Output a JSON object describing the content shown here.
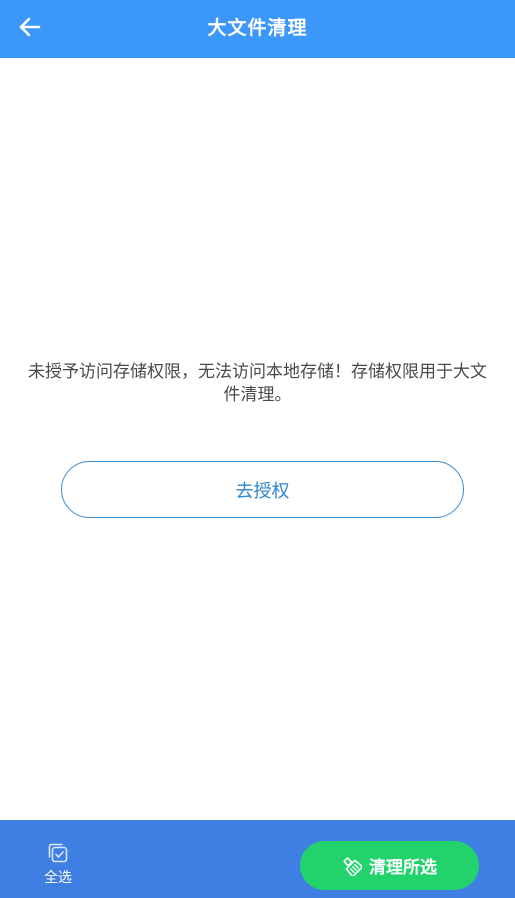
{
  "header": {
    "title": "大文件清理",
    "back_icon": "arrow-left-icon"
  },
  "main": {
    "message": "未授予访问存储权限，无法访问本地存储！存储权限用于大文件清理。",
    "authorize_label": "去授权"
  },
  "footer": {
    "select_all_label": "全选",
    "select_all_icon": "checkbox-stack-icon",
    "clean_label": "清理所选",
    "clean_icon": "broom-icon"
  },
  "colors": {
    "header_bg": "#3c97fa",
    "footer_bg": "#3f7fe3",
    "clean_button_bg": "#22d26b",
    "authorize_border": "#3a8fd6"
  }
}
